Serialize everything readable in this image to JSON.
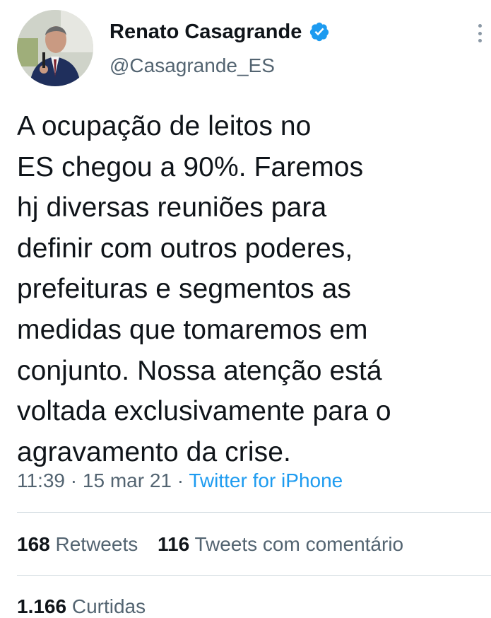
{
  "author": {
    "display_name": "Renato Casagrande",
    "handle": "@Casagrande_ES",
    "verified": true
  },
  "tweet": {
    "lines": [
      "A ocupação de leitos no",
      "ES chegou a 90%. Faremos",
      "hj diversas reuniões para",
      "definir com outros poderes,",
      "prefeituras e segmentos as",
      "medidas que tomaremos em",
      "conjunto. Nossa atenção está",
      "voltada exclusivamente para o",
      "agravamento da crise."
    ],
    "time": "11:39",
    "separator": "·",
    "date": "15 mar 21",
    "source": "Twitter for iPhone"
  },
  "stats": {
    "retweets_count": "168",
    "retweets_label": "Retweets",
    "quotes_count": "116",
    "quotes_label": "Tweets com comentário",
    "likes_count": "1.166",
    "likes_label": "Curtidas"
  },
  "colors": {
    "accent": "#1d9bf0",
    "text": "#0f1419",
    "secondary": "#536471"
  }
}
